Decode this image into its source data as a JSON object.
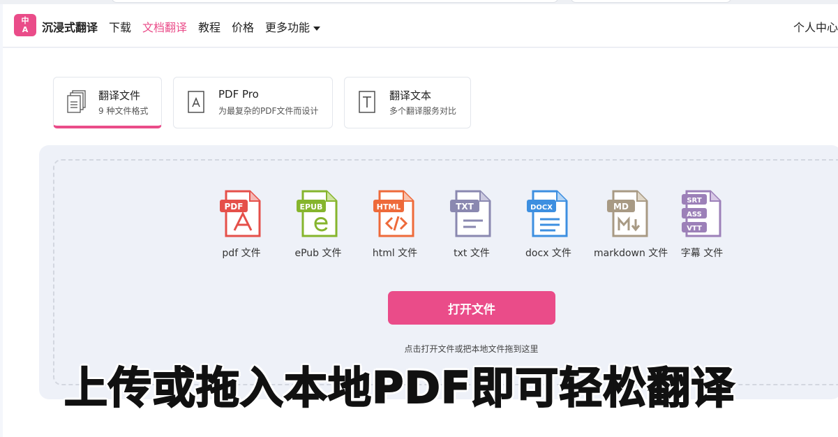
{
  "nav": {
    "logo_text": "中\nA",
    "brand": "沉浸式翻译",
    "items": [
      {
        "label": "下载"
      },
      {
        "label": "文档翻译"
      },
      {
        "label": "教程"
      },
      {
        "label": "价格"
      },
      {
        "label": "更多功能"
      }
    ],
    "user_center": "个人中心"
  },
  "tabs": [
    {
      "title": "翻译文件",
      "subtitle": "9 种文件格式"
    },
    {
      "title": "PDF Pro",
      "subtitle": "为最复杂的PDF文件而设计"
    },
    {
      "title": "翻译文本",
      "subtitle": "多个翻译服务对比"
    }
  ],
  "formats": [
    {
      "badge": "PDF",
      "label": "pdf 文件",
      "color": "#e5504a"
    },
    {
      "badge": "EPUB",
      "label": "ePub 文件",
      "color": "#86b52d"
    },
    {
      "badge": "HTML",
      "label": "html 文件",
      "color": "#ee6a3a"
    },
    {
      "badge": "TXT",
      "label": "txt 文件",
      "color": "#8a88b0"
    },
    {
      "badge": "DOCX",
      "label": "docx 文件",
      "color": "#3d8fe0"
    },
    {
      "badge": "MD",
      "label": "markdown 文件",
      "color": "#a89a84"
    },
    {
      "badge": "SRT",
      "label": "字幕 文件",
      "color": "#9c80b8"
    }
  ],
  "subtitle_badges": [
    "SRT",
    "ASS",
    "VTT"
  ],
  "open_button": "打开文件",
  "hint": "点击打开文件或把本地文件拖到这里",
  "caption": "上传或拖入本地PDF即可轻松翻译",
  "colors": {
    "accent": "#ea4c89",
    "panel": "#eef1f8"
  }
}
